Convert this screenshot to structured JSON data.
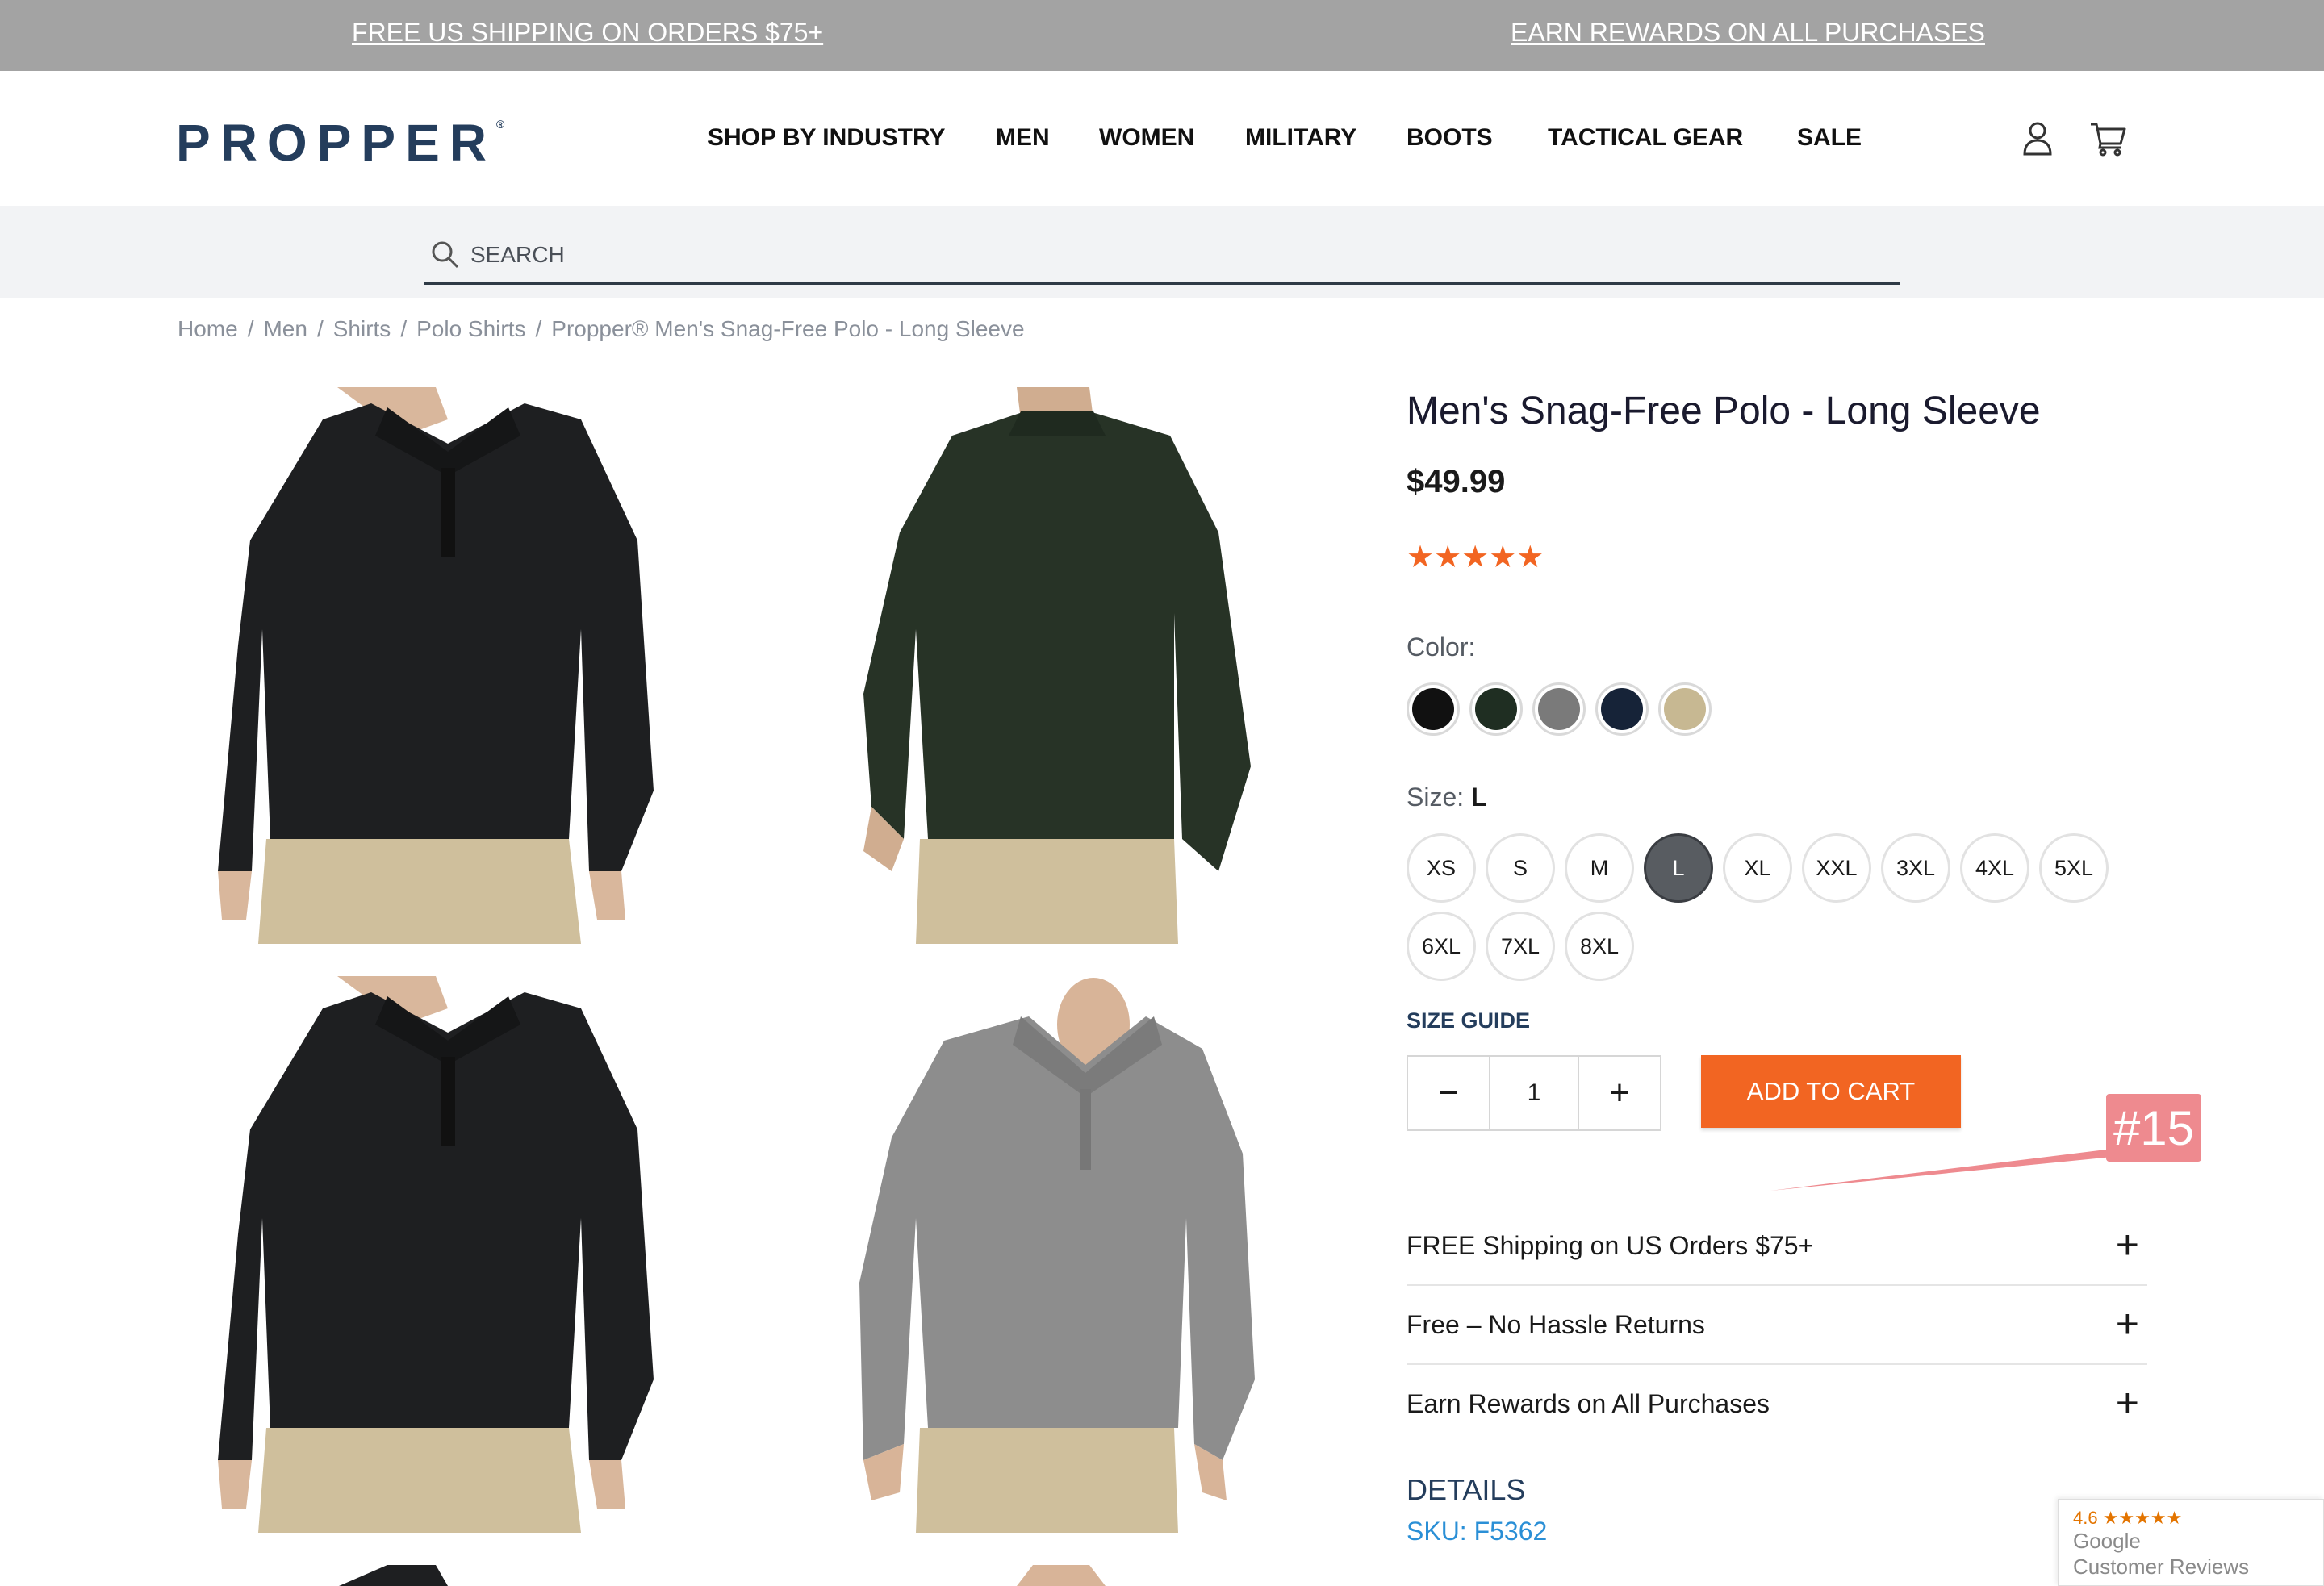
{
  "promo": {
    "left": "FREE US SHIPPING ON ORDERS $75+",
    "right": "EARN REWARDS ON ALL PURCHASES"
  },
  "header": {
    "logo": "PROPPER",
    "logo_mark": "®",
    "nav": [
      "SHOP BY INDUSTRY",
      "MEN",
      "WOMEN",
      "MILITARY",
      "BOOTS",
      "TACTICAL GEAR",
      "SALE"
    ],
    "icons": [
      "account-icon",
      "cart-icon"
    ]
  },
  "search": {
    "placeholder": "SEARCH"
  },
  "breadcrumb": [
    "Home",
    "Men",
    "Shirts",
    "Polo Shirts",
    "Propper® Men's Snag-Free Polo - Long Sleeve"
  ],
  "product": {
    "title": "Men's Snag-Free Polo - Long Sleeve",
    "price": "$49.99",
    "stars": "★★★★★",
    "rating": 5,
    "color_label": "Color:",
    "colors": [
      "#111111",
      "#1f2e22",
      "#7a7a7a",
      "#162338",
      "#c7b892"
    ],
    "size_label": "Size: ",
    "selected_size": "L",
    "sizes": [
      "XS",
      "S",
      "M",
      "L",
      "XL",
      "XXL",
      "3XL",
      "4XL",
      "5XL",
      "6XL",
      "7XL",
      "8XL"
    ],
    "size_guide": "SIZE GUIDE",
    "quantity": "1",
    "minus": "−",
    "plus": "+",
    "add_to_cart": "ADD TO CART",
    "images": [
      "black-polo-front",
      "green-polo-back",
      "black-polo-front-alt",
      "grey-polo-front"
    ]
  },
  "annotation": {
    "marker": "#15"
  },
  "accordion": [
    {
      "label": "FREE Shipping on US Orders $75+",
      "icon": "+"
    },
    {
      "label": "Free – No Hassle Returns",
      "icon": "+"
    },
    {
      "label": "Earn Rewards on All Purchases",
      "icon": "+"
    }
  ],
  "details": {
    "heading": "DETAILS",
    "sku": "SKU: F5362"
  },
  "reviews_badge": {
    "rating": "4.6 ★★★★★",
    "line1": "Google",
    "line2": "Customer Reviews"
  },
  "colors": {
    "accent": "#f26522",
    "brand_navy": "#243d5c",
    "promo_bg": "#a3a3a3",
    "link_blue": "#2a8fd6"
  }
}
